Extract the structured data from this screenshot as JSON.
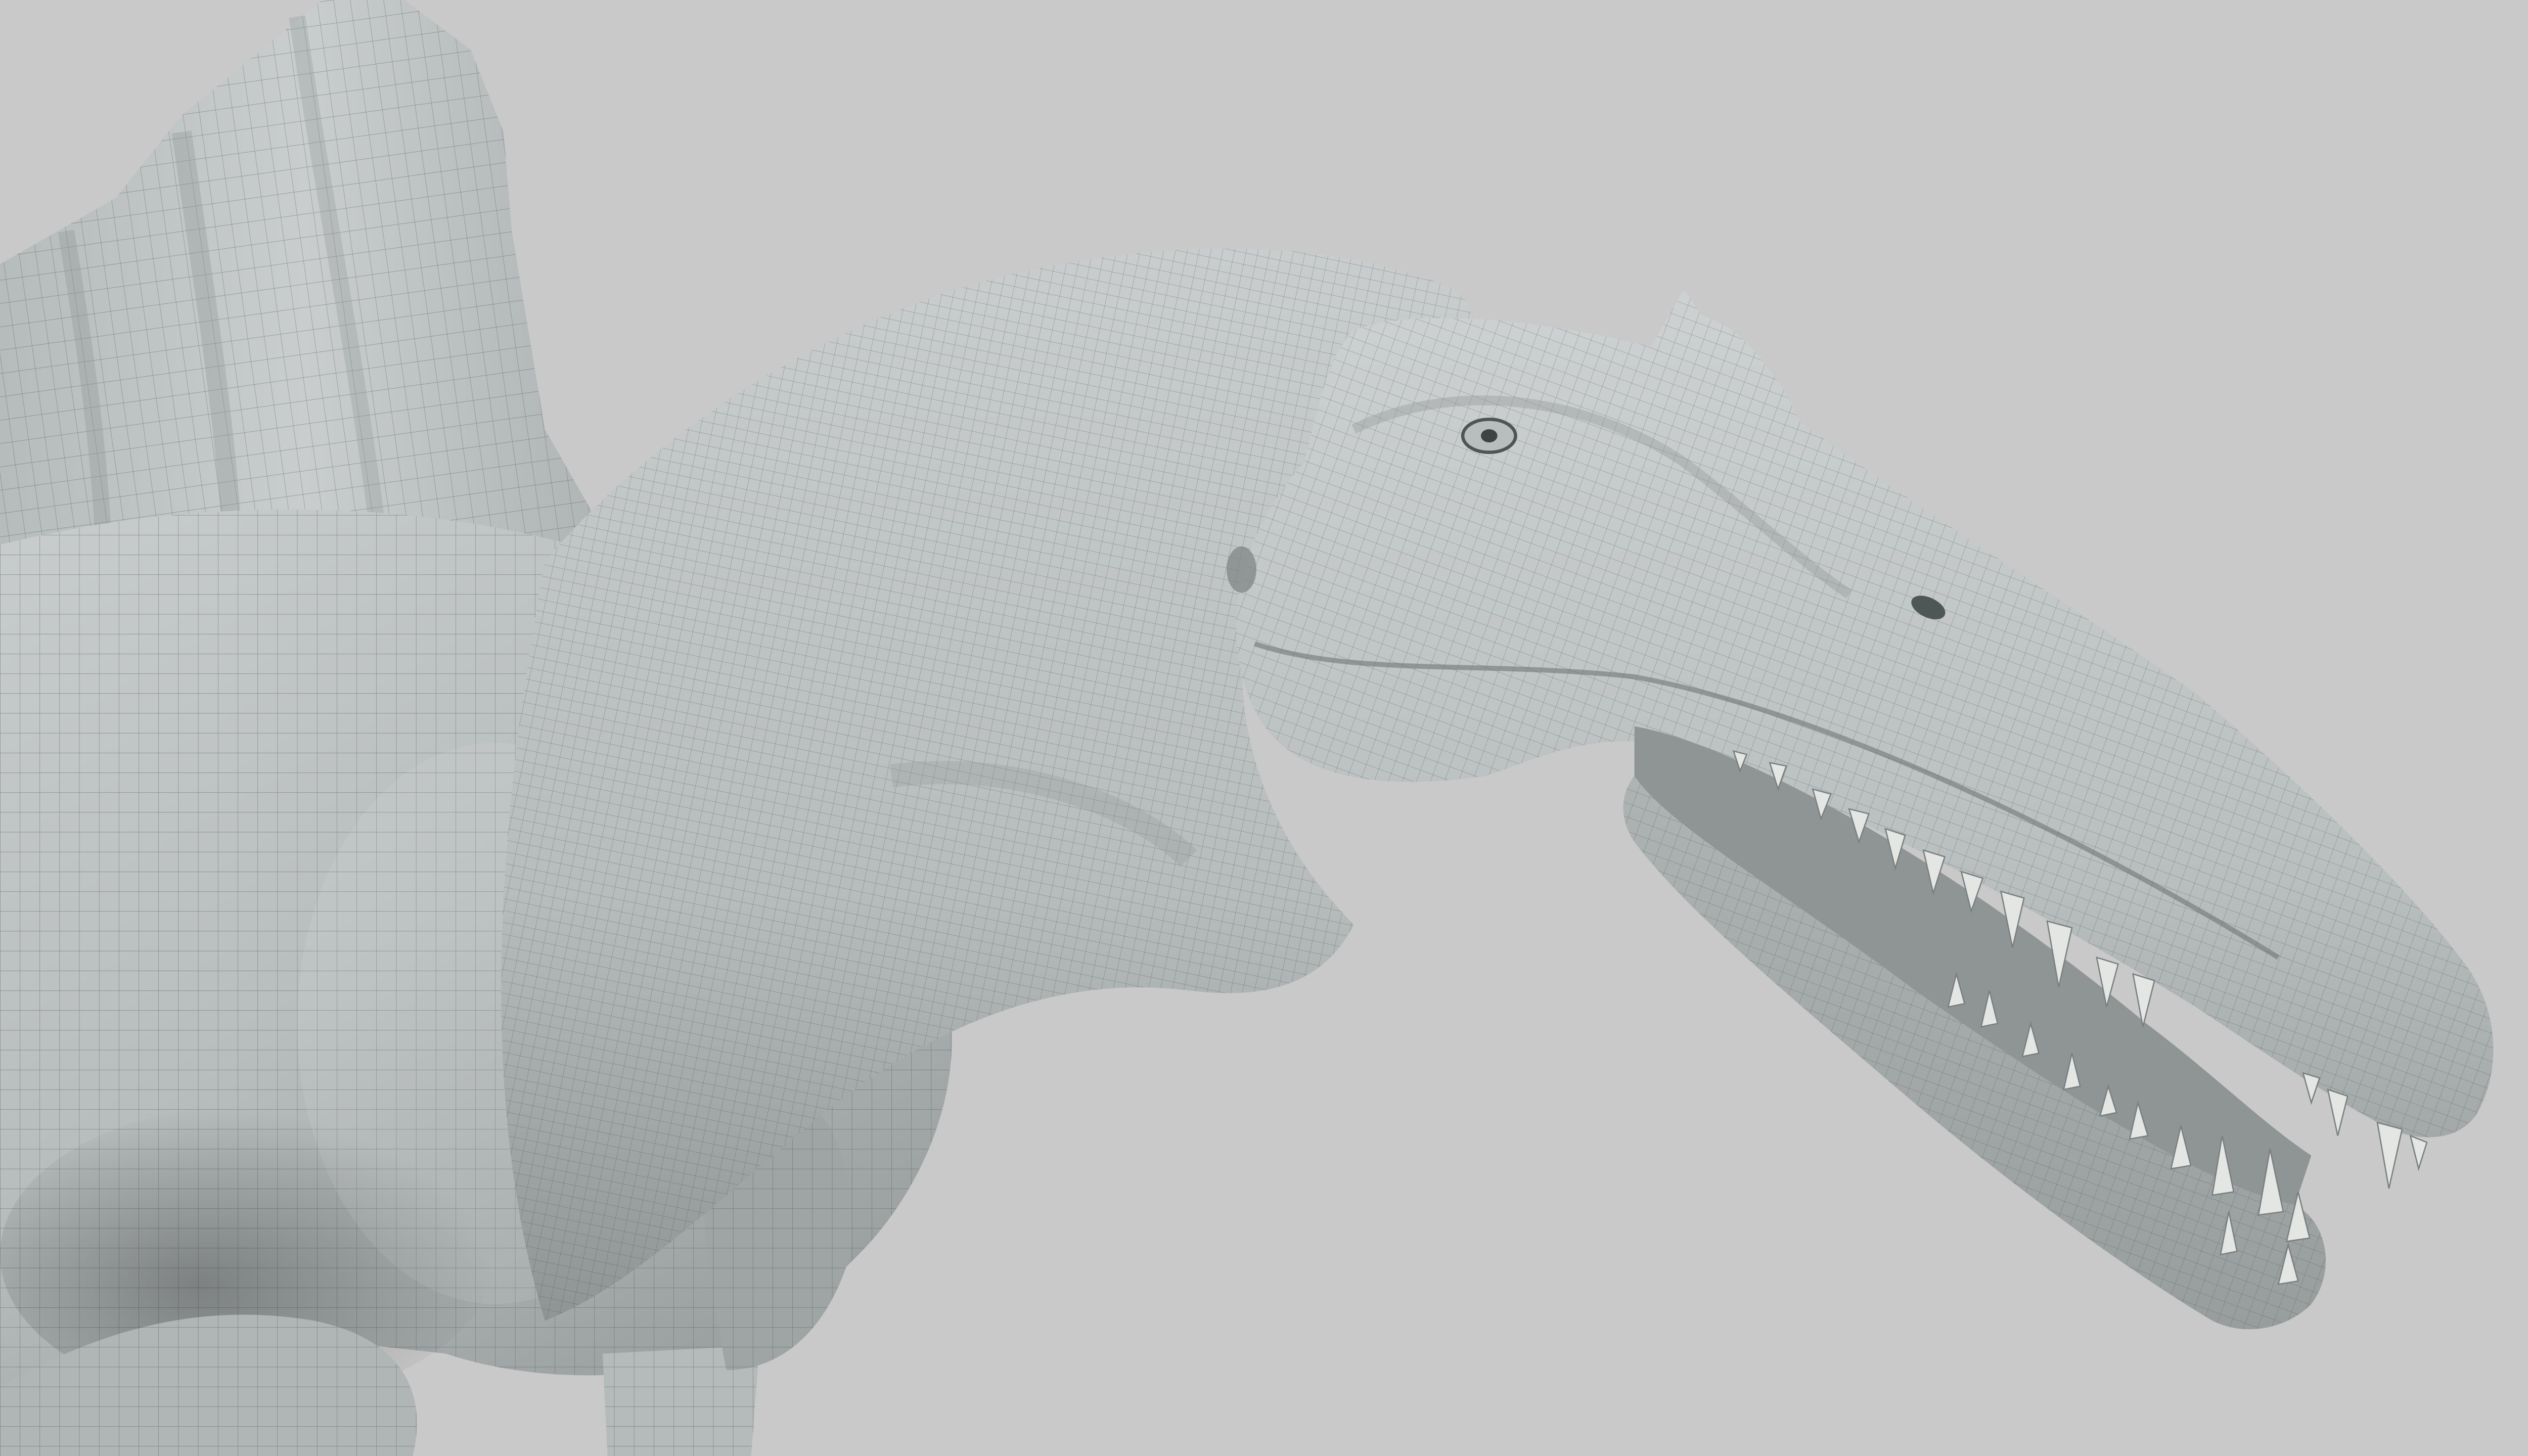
{
  "viewport": {
    "background_color": "#c9c9c9",
    "render_mode": "shaded-wireframe",
    "subject": "spinosaurus-model"
  },
  "colors": {
    "surface_light": "#c4c8c8",
    "surface_mid": "#a9aeae",
    "surface_dark": "#7c8282",
    "wire": "#4a5152",
    "tooth": "#e4e6e4",
    "mouth_dark": "#8f9494"
  }
}
